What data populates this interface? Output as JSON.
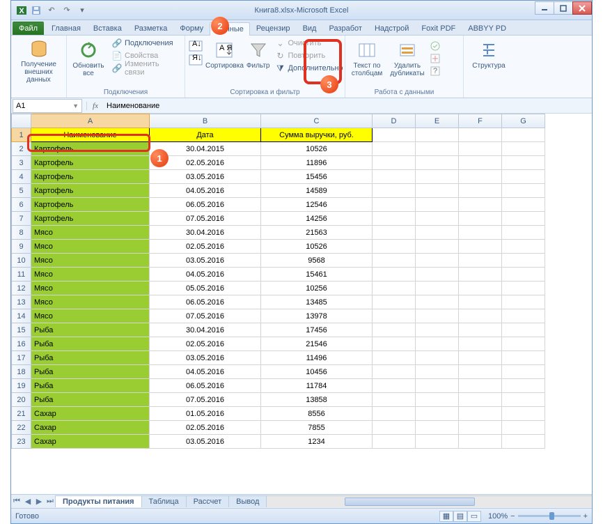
{
  "title": {
    "doc": "Книга8.xlsx",
    "app": "Microsoft Excel",
    "sep": " - "
  },
  "tabs": [
    "Файл",
    "Главная",
    "Вставка",
    "Разметка",
    "Форму",
    "Данные",
    "Рецензир",
    "Вид",
    "Разработ",
    "Надстрой",
    "Foxit PDF",
    "ABBYY PD"
  ],
  "active_tab": 5,
  "ribbon": {
    "g1": {
      "btn": "Получение\nвнешних данных"
    },
    "g2": {
      "btn": "Обновить\nвсе",
      "s1": "Подключения",
      "s2": "Свойства",
      "s3": "Изменить связи",
      "label": "Подключения"
    },
    "g3": {
      "sort_btn": "Сортировка",
      "filter_btn": "Фильтр",
      "s1": "Очистить",
      "s2": "Повторить",
      "s3": "Дополнительно",
      "label": "Сортировка и фильтр"
    },
    "g4": {
      "b1": "Текст по\nстолбцам",
      "b2": "Удалить\nдубликаты",
      "label": "Работа с данными"
    },
    "g5": {
      "btn": "Структура"
    }
  },
  "namebox": "A1",
  "formula": "Наименование",
  "cols": [
    "A",
    "B",
    "C",
    "D",
    "E",
    "F",
    "G"
  ],
  "headers": [
    "Наименование",
    "Дата",
    "Сумма выручки, руб."
  ],
  "rows": [
    [
      "Картофель",
      "30.04.2015",
      "10526"
    ],
    [
      "Картофель",
      "02.05.2016",
      "11896"
    ],
    [
      "Картофель",
      "03.05.2016",
      "15456"
    ],
    [
      "Картофель",
      "04.05.2016",
      "14589"
    ],
    [
      "Картофель",
      "06.05.2016",
      "12546"
    ],
    [
      "Картофель",
      "07.05.2016",
      "14256"
    ],
    [
      "Мясо",
      "30.04.2016",
      "21563"
    ],
    [
      "Мясо",
      "02.05.2016",
      "10526"
    ],
    [
      "Мясо",
      "03.05.2016",
      "9568"
    ],
    [
      "Мясо",
      "04.05.2016",
      "15461"
    ],
    [
      "Мясо",
      "05.05.2016",
      "10256"
    ],
    [
      "Мясо",
      "06.05.2016",
      "13485"
    ],
    [
      "Мясо",
      "07.05.2016",
      "13978"
    ],
    [
      "Рыба",
      "30.04.2016",
      "17456"
    ],
    [
      "Рыба",
      "02.05.2016",
      "21546"
    ],
    [
      "Рыба",
      "03.05.2016",
      "11496"
    ],
    [
      "Рыба",
      "04.05.2016",
      "10456"
    ],
    [
      "Рыба",
      "06.05.2016",
      "11784"
    ],
    [
      "Рыба",
      "07.05.2016",
      "13858"
    ],
    [
      "Сахар",
      "01.05.2016",
      "8556"
    ],
    [
      "Сахар",
      "02.05.2016",
      "7855"
    ],
    [
      "Сахар",
      "03.05.2016",
      "1234"
    ]
  ],
  "sheets": [
    "Продукты питания",
    "Таблица",
    "Рассчет",
    "Вывод"
  ],
  "status": "Готово",
  "zoom": "100%"
}
